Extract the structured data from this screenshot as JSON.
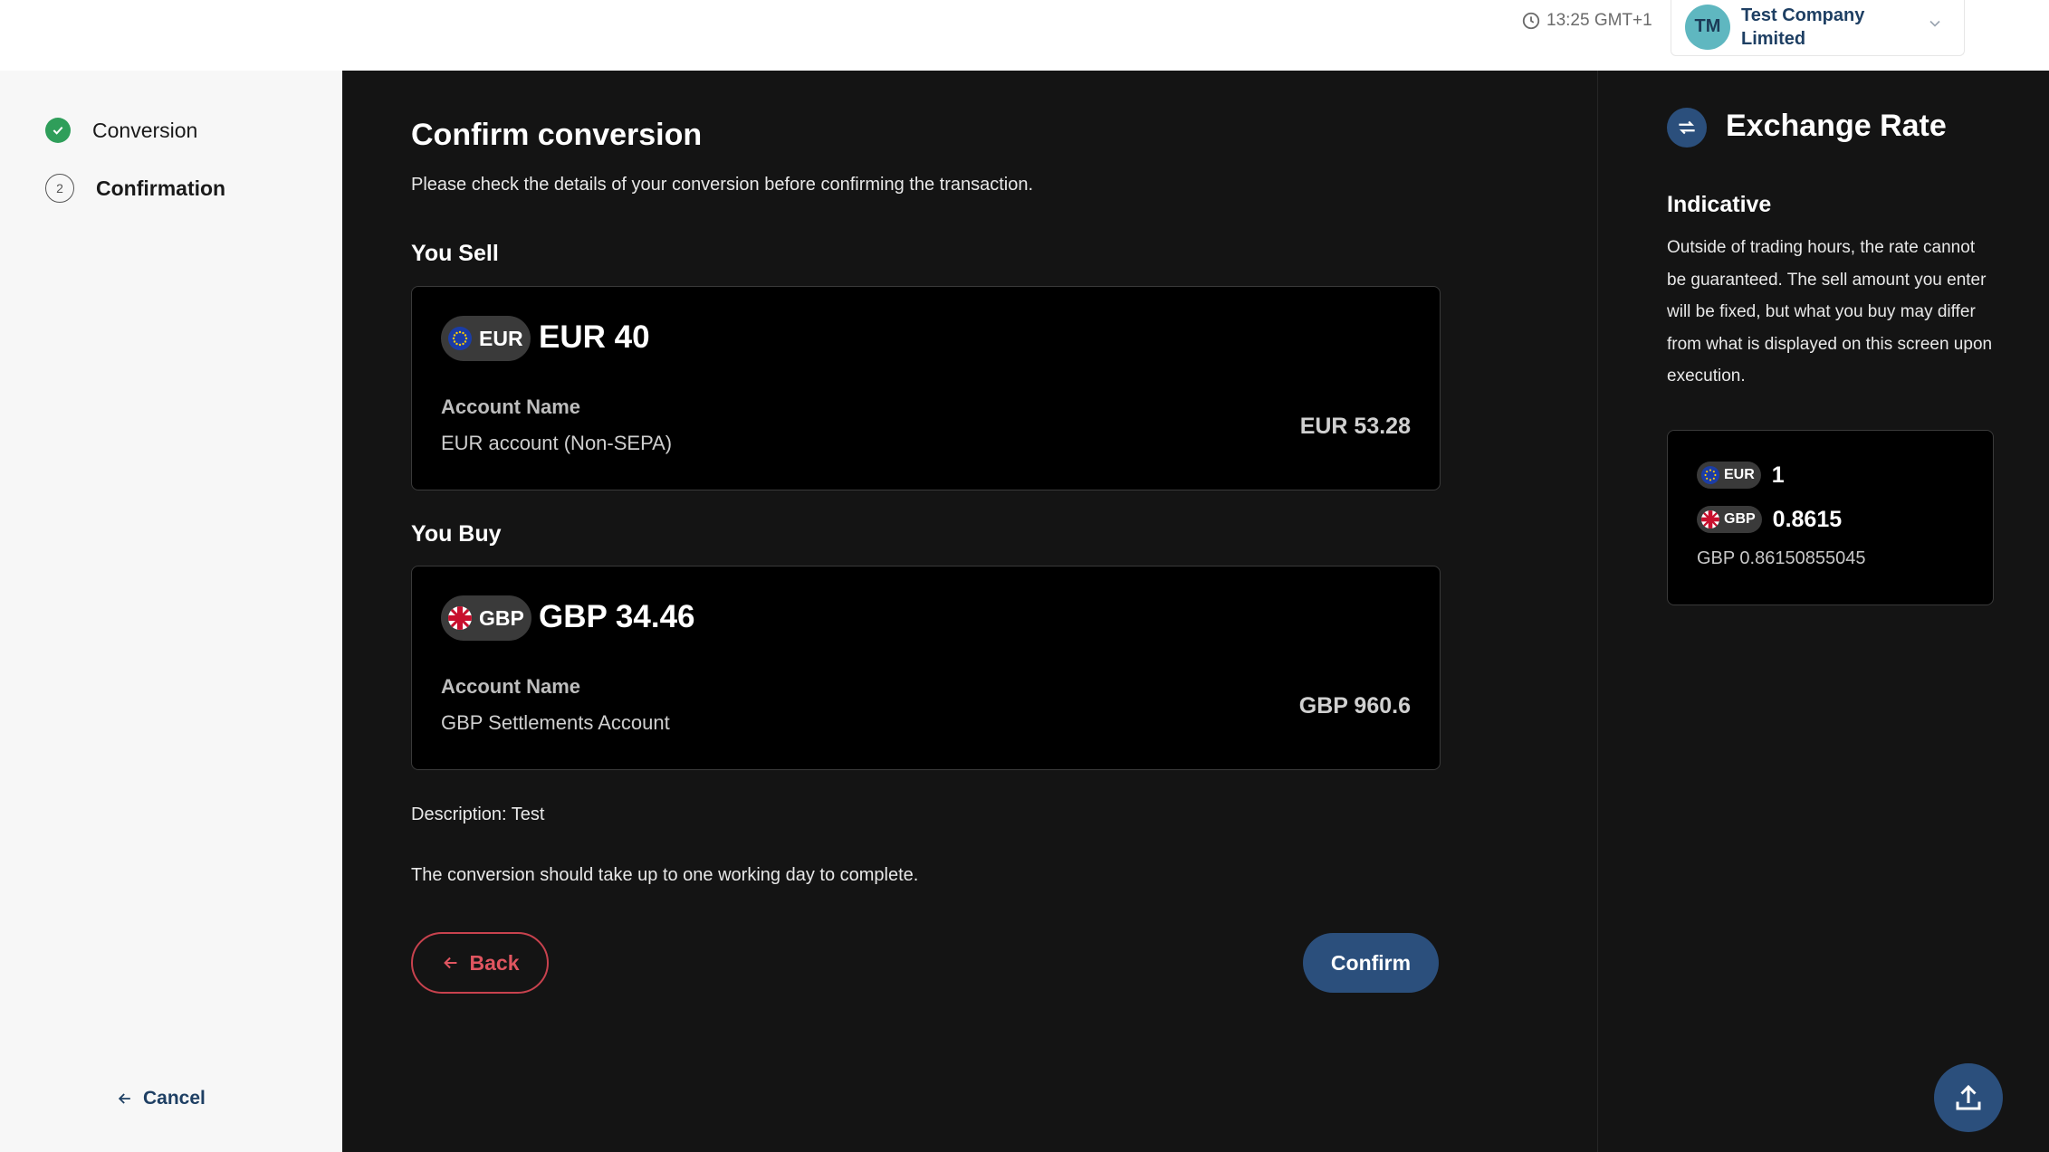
{
  "header": {
    "time": "13:25 GMT+1",
    "avatar_initials": "TM",
    "company_name": "Test Company Limited"
  },
  "sidebar": {
    "steps": [
      {
        "label": "Conversion",
        "status": "complete"
      },
      {
        "label": "Confirmation",
        "number": "2",
        "status": "current"
      }
    ],
    "cancel_label": "Cancel"
  },
  "main": {
    "title": "Confirm conversion",
    "subtitle": "Please check the details of your conversion before confirming the transaction.",
    "sell": {
      "section_title": "You Sell",
      "currency": "EUR",
      "amount": "EUR 40",
      "account_label": "Account Name",
      "account_name": "EUR account (Non-SEPA)",
      "balance": "EUR 53.28"
    },
    "buy": {
      "section_title": "You Buy",
      "currency": "GBP",
      "amount": "GBP 34.46",
      "account_label": "Account Name",
      "account_name": "GBP Settlements Account",
      "balance": "GBP 960.6"
    },
    "description": "Description: Test",
    "note": "The conversion should take up to one working day to complete.",
    "back_label": "Back",
    "confirm_label": "Confirm"
  },
  "rate_panel": {
    "title": "Exchange Rate",
    "subtitle": "Indicative",
    "text": "Outside of trading hours, the rate cannot be guaranteed. The sell amount you enter will be fixed, but what you buy may differ from what is displayed on this screen upon execution.",
    "from_currency": "EUR",
    "from_value": "1",
    "to_currency": "GBP",
    "to_value": "0.8615",
    "exact_rate": "GBP 0.86150855045"
  },
  "colors": {
    "accent": "#2b4f7c",
    "danger": "#c8424e",
    "success": "#2f9e5a",
    "avatar": "#5fb7c0"
  },
  "icons": [
    "clock-icon",
    "chevron-down-icon",
    "check-icon",
    "arrow-left-icon",
    "eu-flag-icon",
    "uk-flag-icon",
    "exchange-icon",
    "upload-icon"
  ]
}
